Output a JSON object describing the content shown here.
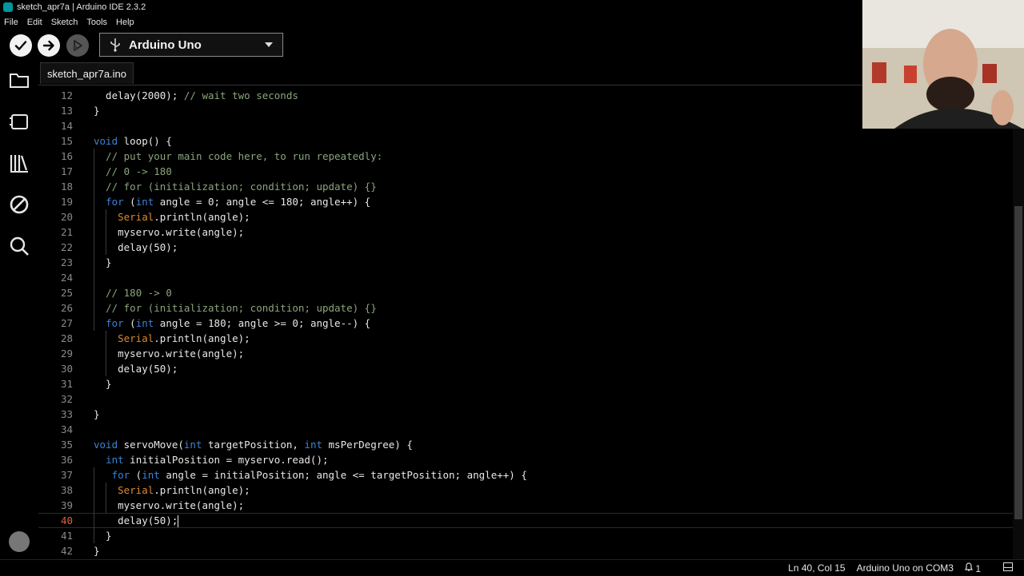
{
  "window": {
    "title": "sketch_apr7a | Arduino IDE 2.3.2"
  },
  "menu": [
    "File",
    "Edit",
    "Sketch",
    "Tools",
    "Help"
  ],
  "toolbar": {
    "verify": "verify-icon",
    "upload": "upload-icon",
    "debug": "debug-icon",
    "board": "Arduino Uno"
  },
  "tab": {
    "label": "sketch_apr7a.ino"
  },
  "sidebar": [
    "folder-icon",
    "board-manager-icon",
    "library-icon",
    "debug-disable-icon",
    "search-icon",
    "account-avatar"
  ],
  "lines": [
    {
      "n": "12",
      "code": "  delay(2000); // wait two seconds"
    },
    {
      "n": "13",
      "code": "}"
    },
    {
      "n": "14",
      "code": ""
    },
    {
      "n": "15",
      "code": "void loop() {"
    },
    {
      "n": "16",
      "code": "  // put your main code here, to run repeatedly:"
    },
    {
      "n": "17",
      "code": "  // 0 -> 180"
    },
    {
      "n": "18",
      "code": "  // for (initialization; condition; update) {}"
    },
    {
      "n": "19",
      "code": "  for (int angle = 0; angle <= 180; angle++) {"
    },
    {
      "n": "20",
      "code": "    Serial.println(angle);"
    },
    {
      "n": "21",
      "code": "    myservo.write(angle);"
    },
    {
      "n": "22",
      "code": "    delay(50);"
    },
    {
      "n": "23",
      "code": "  }"
    },
    {
      "n": "24",
      "code": ""
    },
    {
      "n": "25",
      "code": "  // 180 -> 0"
    },
    {
      "n": "26",
      "code": "  // for (initialization; condition; update) {}"
    },
    {
      "n": "27",
      "code": "  for (int angle = 180; angle >= 0; angle--) {"
    },
    {
      "n": "28",
      "code": "    Serial.println(angle);"
    },
    {
      "n": "29",
      "code": "    myservo.write(angle);"
    },
    {
      "n": "30",
      "code": "    delay(50);"
    },
    {
      "n": "31",
      "code": "  }"
    },
    {
      "n": "32",
      "code": ""
    },
    {
      "n": "33",
      "code": "}"
    },
    {
      "n": "34",
      "code": ""
    },
    {
      "n": "35",
      "code": "void servoMove(int targetPosition, int msPerDegree) {"
    },
    {
      "n": "36",
      "code": "  int initialPosition = myservo.read();"
    },
    {
      "n": "37",
      "code": "   for (int angle = initialPosition; angle <= targetPosition; angle++) {"
    },
    {
      "n": "38",
      "code": "    Serial.println(angle);"
    },
    {
      "n": "39",
      "code": "    myservo.write(angle);"
    },
    {
      "n": "40",
      "code": "    delay(50);"
    },
    {
      "n": "41",
      "code": "  }"
    },
    {
      "n": "42",
      "code": "}"
    }
  ],
  "current_line": "40",
  "status": {
    "position": "Ln 40, Col 15",
    "board": "Arduino Uno on COM3",
    "notifications": "1"
  }
}
